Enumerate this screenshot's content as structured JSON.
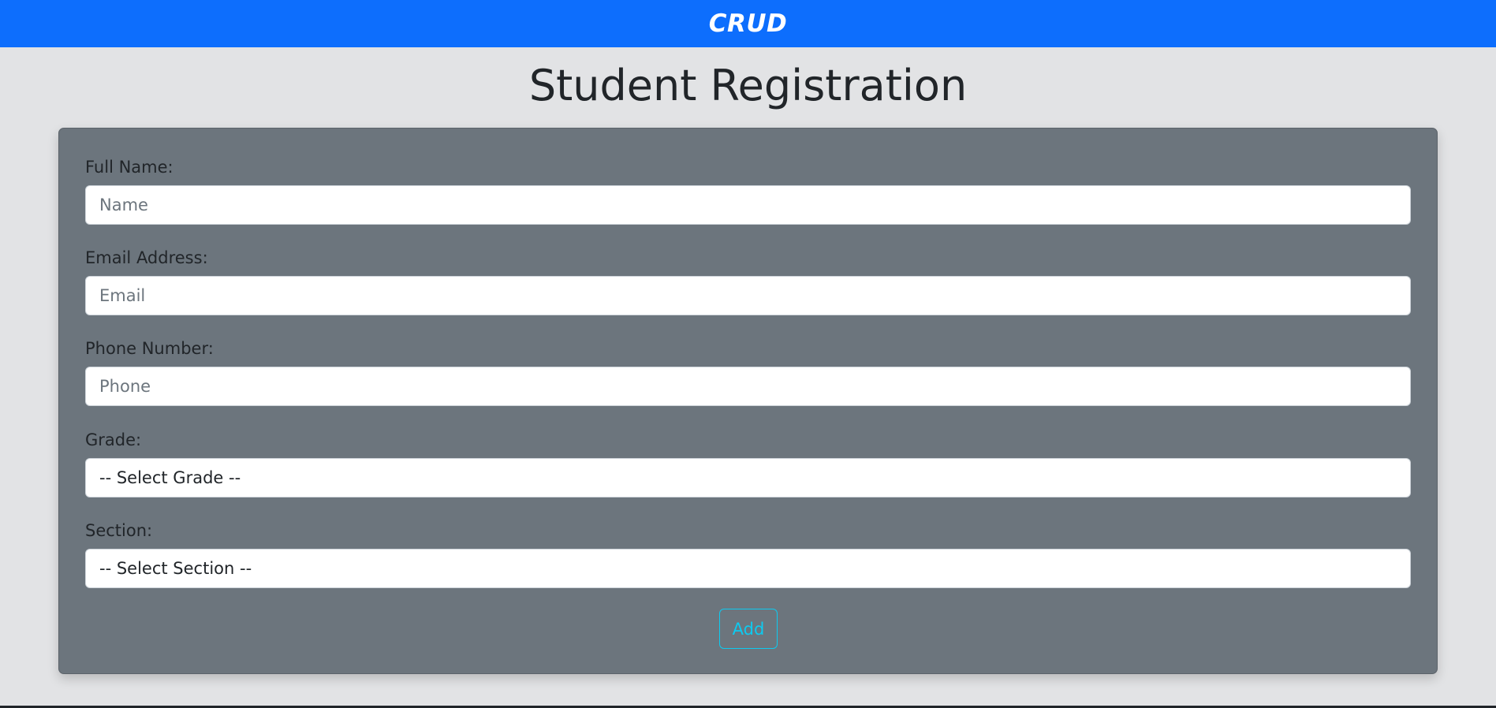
{
  "navbar": {
    "brand": "CRUD",
    "color": "#0d6efd"
  },
  "page": {
    "title": "Student Registration"
  },
  "form": {
    "background": "#6c757d",
    "full_name": {
      "label": "Full Name:",
      "placeholder": "Name"
    },
    "email": {
      "label": "Email Address:",
      "placeholder": "Email"
    },
    "phone": {
      "label": "Phone Number:",
      "placeholder": "Phone"
    },
    "grade": {
      "label": "Grade:",
      "selected": "-- Select Grade --"
    },
    "section": {
      "label": "Section:",
      "selected": "-- Select Section --"
    },
    "add_label": "Add",
    "add_color": "#0dcaf0"
  }
}
